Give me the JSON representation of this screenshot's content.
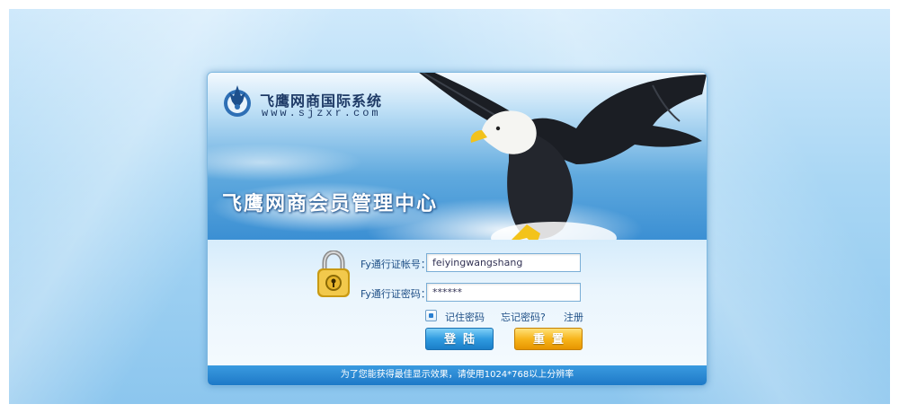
{
  "brand": {
    "title": "飞鹰网商国际系统",
    "url": "www.sjzxr.com"
  },
  "banner": {
    "headline": "飞鹰网商会员管理中心"
  },
  "form": {
    "account_label": "Fy通行证帐号：",
    "account_value": "feiyingwangshang",
    "password_label": "Fy通行证密码：",
    "password_value": "******",
    "remember_label": "记住密码",
    "remember_checked": true,
    "forgot_label": "忘记密码?",
    "register_label": "注册",
    "login_button": "登陆",
    "reset_button": "重置"
  },
  "footer": {
    "notice": "为了您能获得最佳显示效果，请使用1024*768以上分辨率"
  },
  "colors": {
    "accent_blue": "#1e79c7",
    "button_orange": "#f7b51b",
    "text_blue": "#1e4f86"
  }
}
